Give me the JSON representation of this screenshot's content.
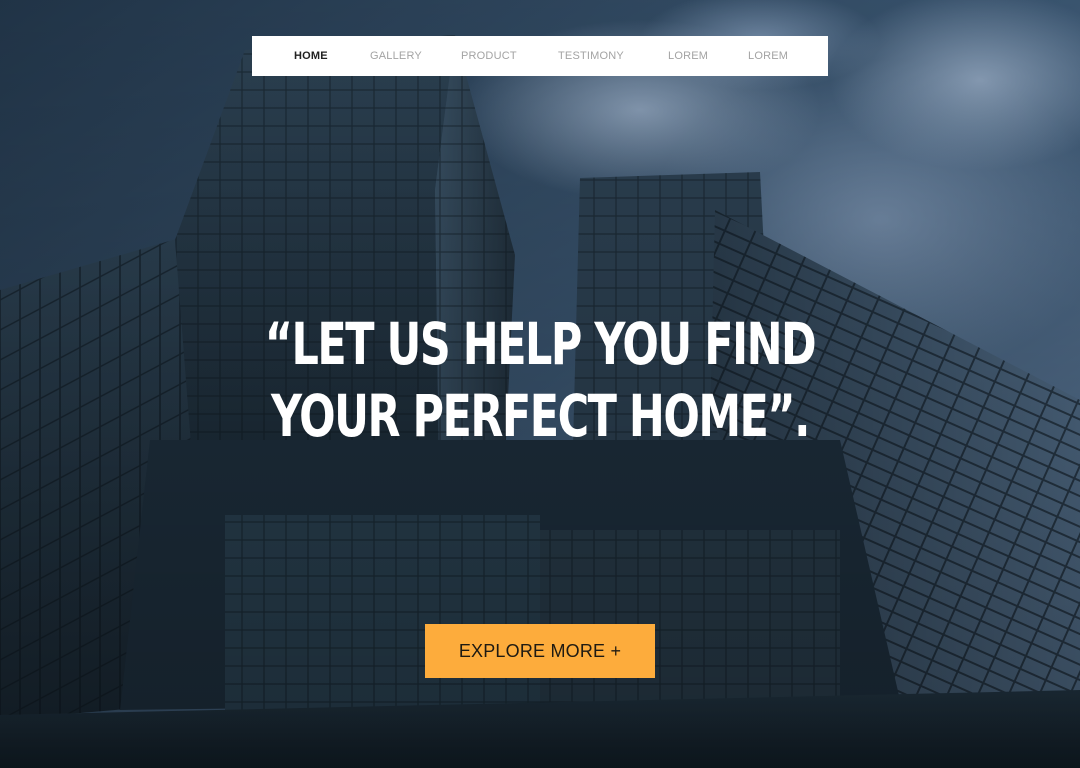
{
  "nav": {
    "items": [
      {
        "label": "HOME",
        "active": true
      },
      {
        "label": "GALLERY",
        "active": false
      },
      {
        "label": "PRODUCT",
        "active": false
      },
      {
        "label": "TESTIMONY",
        "active": false
      },
      {
        "label": "LOREM",
        "active": false
      },
      {
        "label": "LOREM",
        "active": false
      }
    ]
  },
  "hero": {
    "headline_line_1": "“LET US HELP YOU FIND",
    "headline_line_2": "YOUR PERFECT HOME”.",
    "cta_label": "EXPLORE MORE +",
    "image": "skyscrapers-looking-up-photo"
  },
  "colors": {
    "accent": "#fdac3c",
    "nav_active": "#222222",
    "nav_inactive": "#a3a3a3",
    "headline": "#ffffff"
  }
}
